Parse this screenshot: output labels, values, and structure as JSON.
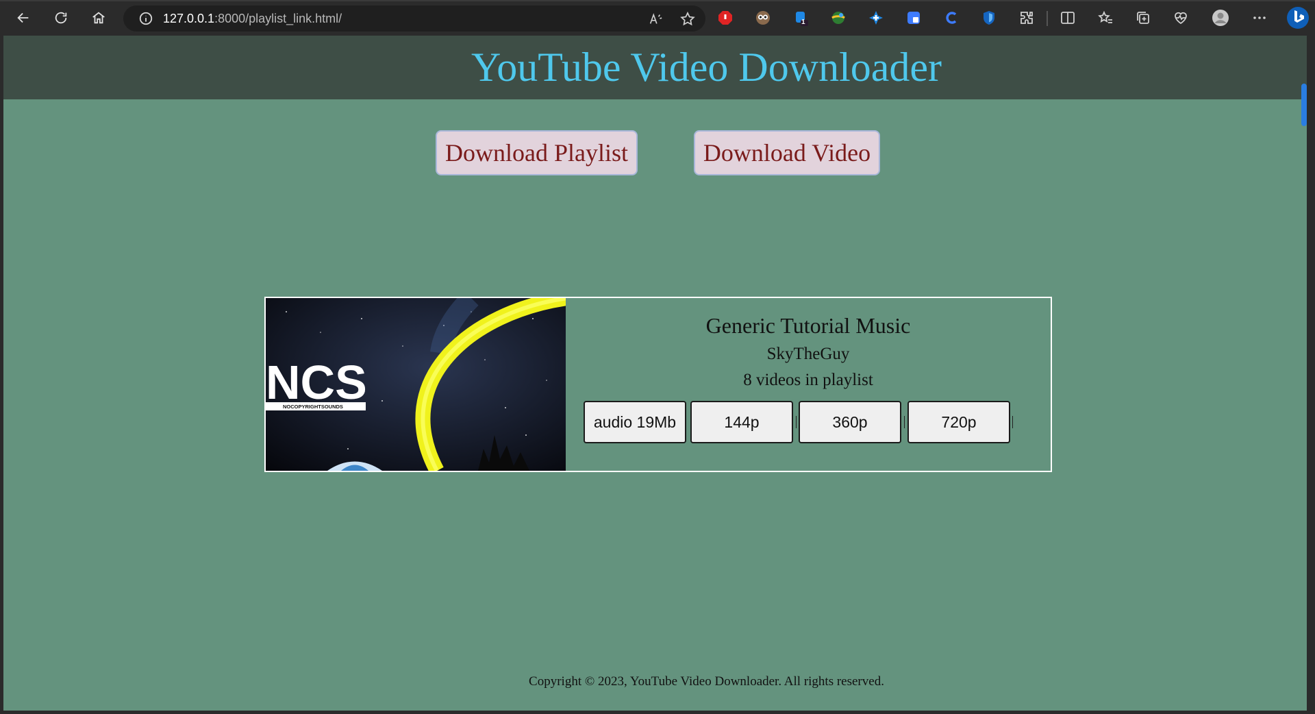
{
  "browser": {
    "url_host": "127.0.0.1",
    "url_path": ":8000/playlist_link.html/",
    "extension_badge_count": "1"
  },
  "header": {
    "title": "YouTube Video Downloader"
  },
  "actions": {
    "download_playlist": "Download Playlist",
    "download_video": "Download Video"
  },
  "playlist": {
    "thumbnail_logo": "NCS",
    "thumbnail_sub": "NOCOPYRIGHTSOUNDS",
    "title": "Generic Tutorial Music",
    "channel": "SkyTheGuy",
    "count": "8 videos in playlist",
    "formats": [
      "audio 19Mb",
      "144p",
      "360p",
      "720p"
    ]
  },
  "footer": {
    "text": "Copyright © 2023, YouTube Video Downloader. All rights reserved."
  },
  "colors": {
    "page_bg": "#64937e",
    "header_bg": "#3e4e46",
    "title_color": "#4fc8ec",
    "button_bg": "#e2d3dc",
    "button_text": "#7a1b1b"
  }
}
